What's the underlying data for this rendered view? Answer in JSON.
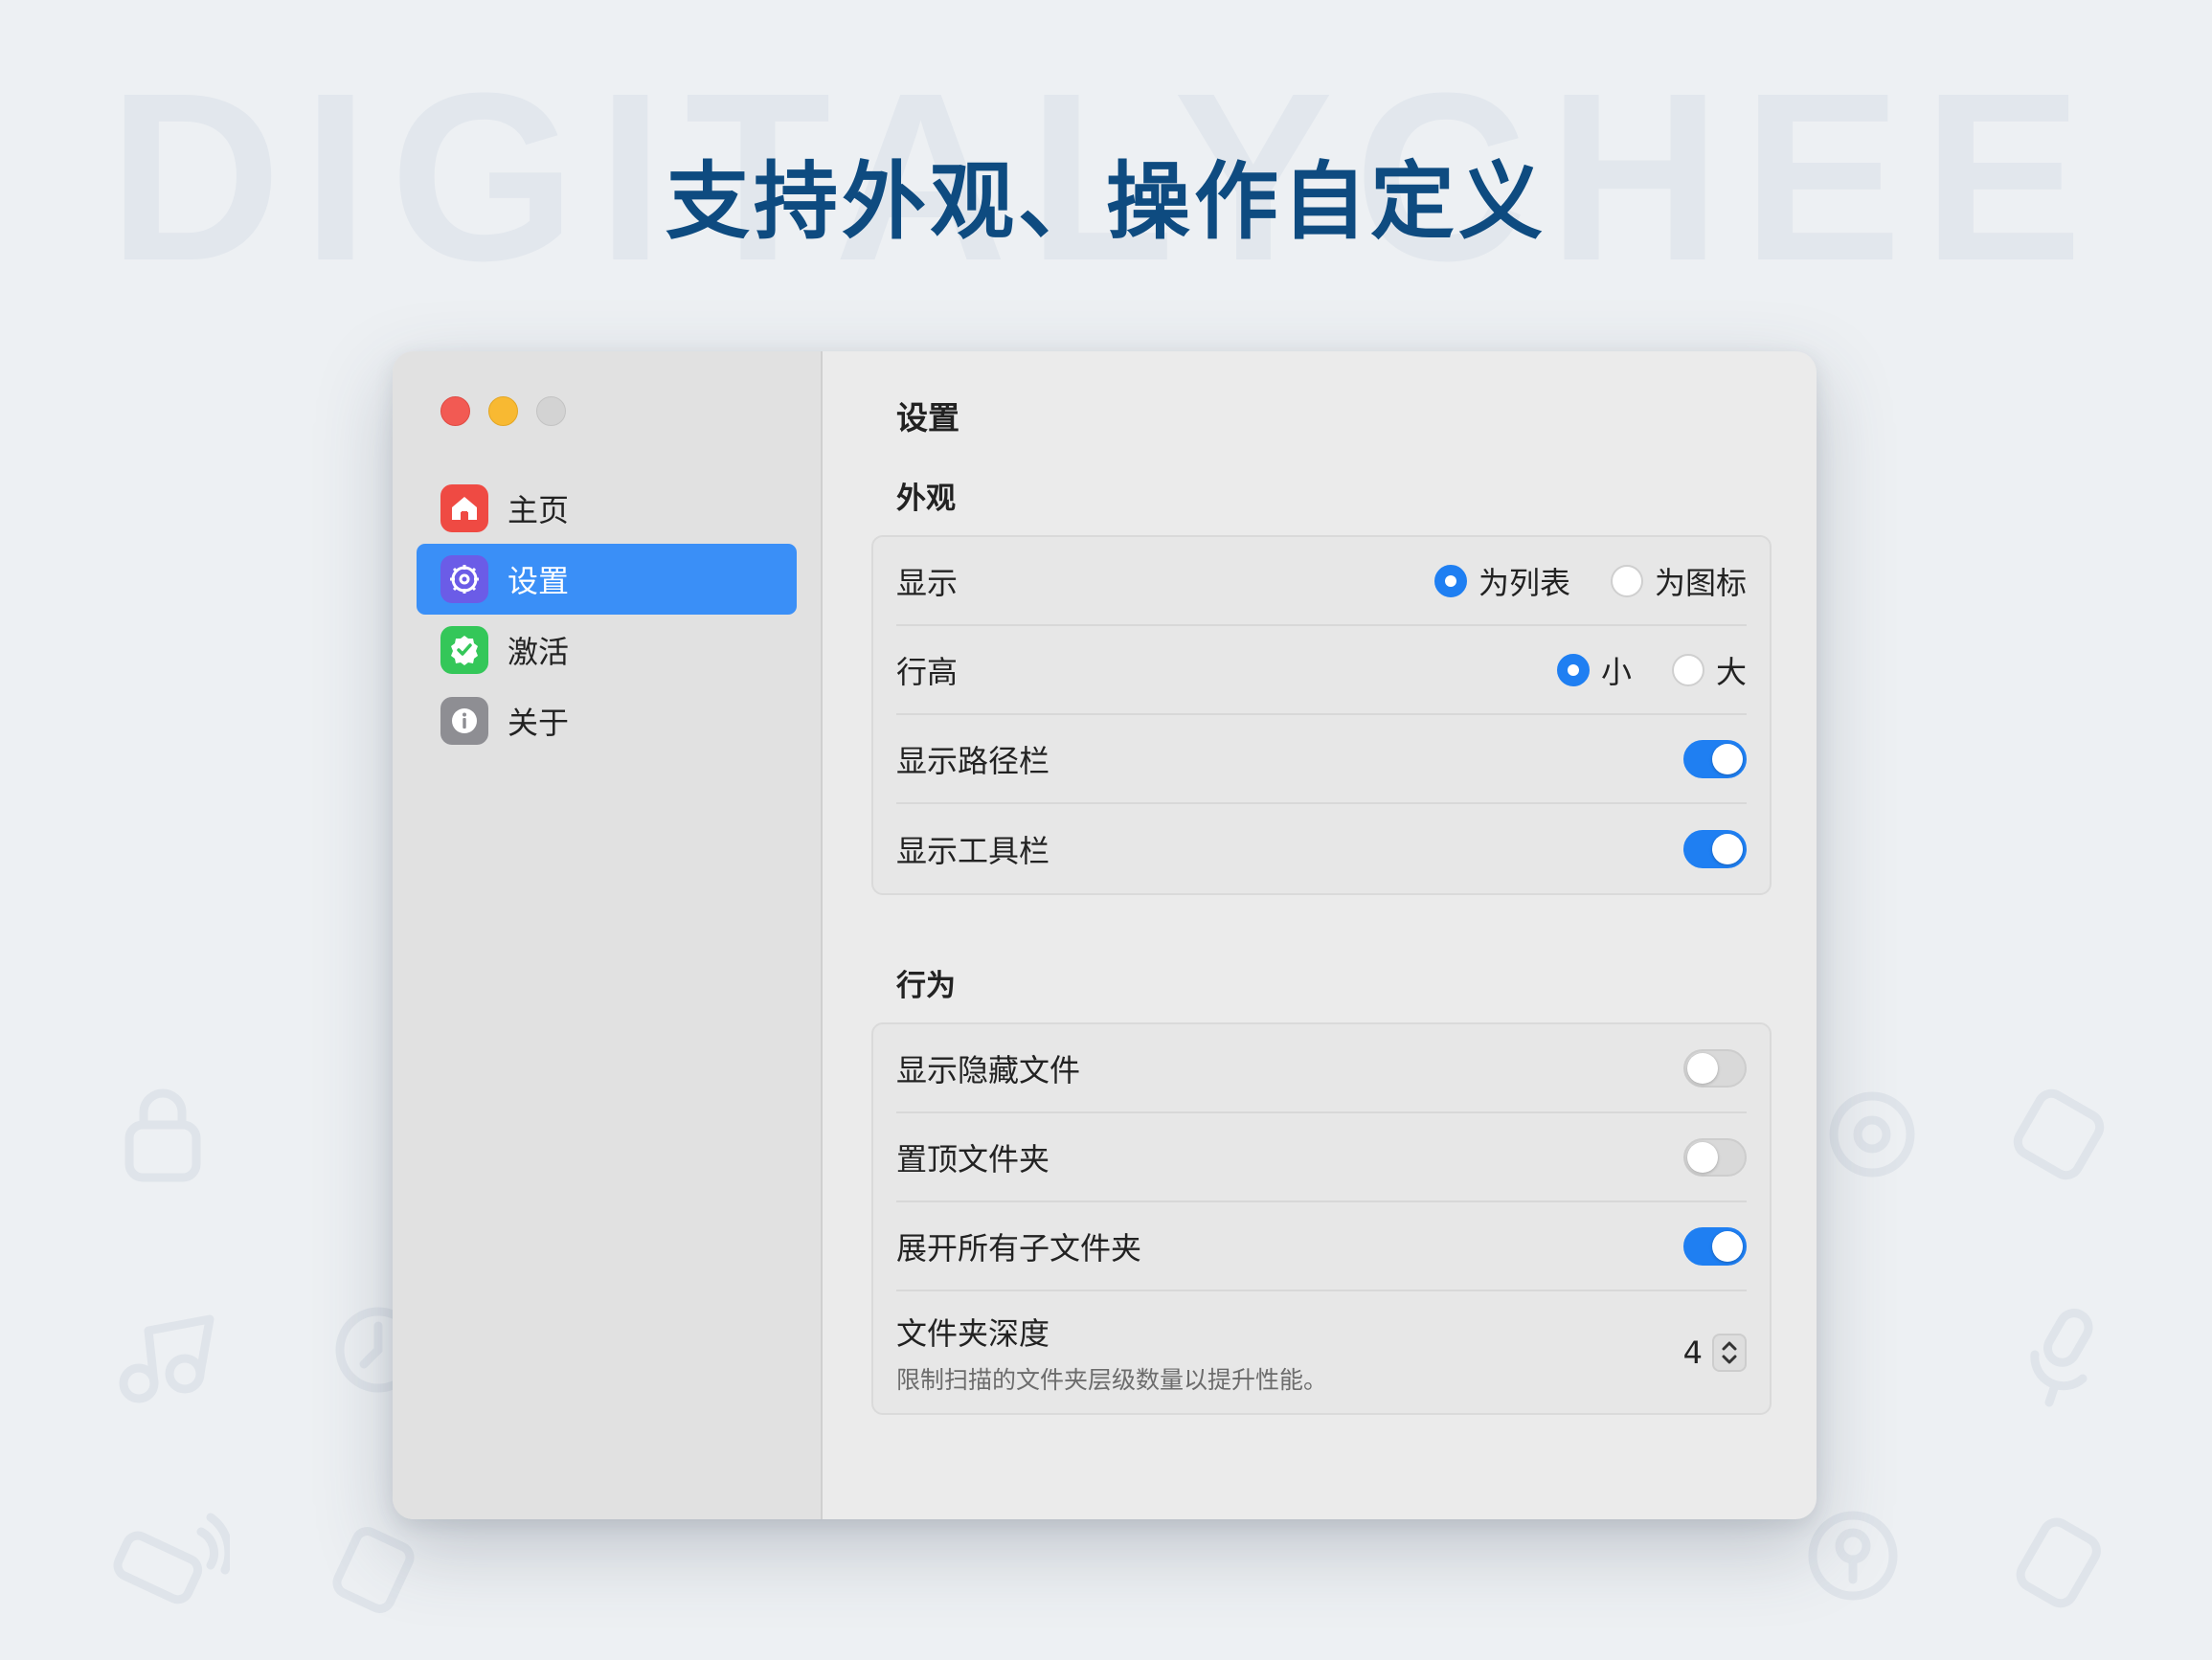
{
  "watermark": "DIGITALYCHEE",
  "headline": "支持外观、操作自定义",
  "colors": {
    "accent": "#1f7ff2",
    "sidebar_active": "#3a8ff7",
    "headline": "#0e4b80"
  },
  "sidebar": {
    "items": [
      {
        "label": "主页",
        "icon": "house-icon",
        "color": "#ef4a43",
        "active": false
      },
      {
        "label": "设置",
        "icon": "gear-icon",
        "color": "#6b5ce7",
        "active": true
      },
      {
        "label": "激活",
        "icon": "checkmark-seal-icon",
        "color": "#34c759",
        "active": false
      },
      {
        "label": "关于",
        "icon": "info-icon",
        "color": "#8e8e93",
        "active": false
      }
    ]
  },
  "main": {
    "title": "设置",
    "appearance": {
      "title": "外观",
      "display": {
        "label": "显示",
        "options": [
          "为列表",
          "为图标"
        ],
        "selected": "为列表"
      },
      "row_height": {
        "label": "行高",
        "options": [
          "小",
          "大"
        ],
        "selected": "小"
      },
      "show_path_bar": {
        "label": "显示路径栏",
        "on": true
      },
      "show_toolbar": {
        "label": "显示工具栏",
        "on": true
      }
    },
    "behavior": {
      "title": "行为",
      "show_hidden_files": {
        "label": "显示隐藏文件",
        "on": false
      },
      "pin_folders_top": {
        "label": "置顶文件夹",
        "on": false
      },
      "expand_all_subfolders": {
        "label": "展开所有子文件夹",
        "on": true
      },
      "folder_depth": {
        "label": "文件夹深度",
        "description": "限制扫描的文件夹层级数量以提升性能。",
        "value": "4"
      }
    }
  }
}
